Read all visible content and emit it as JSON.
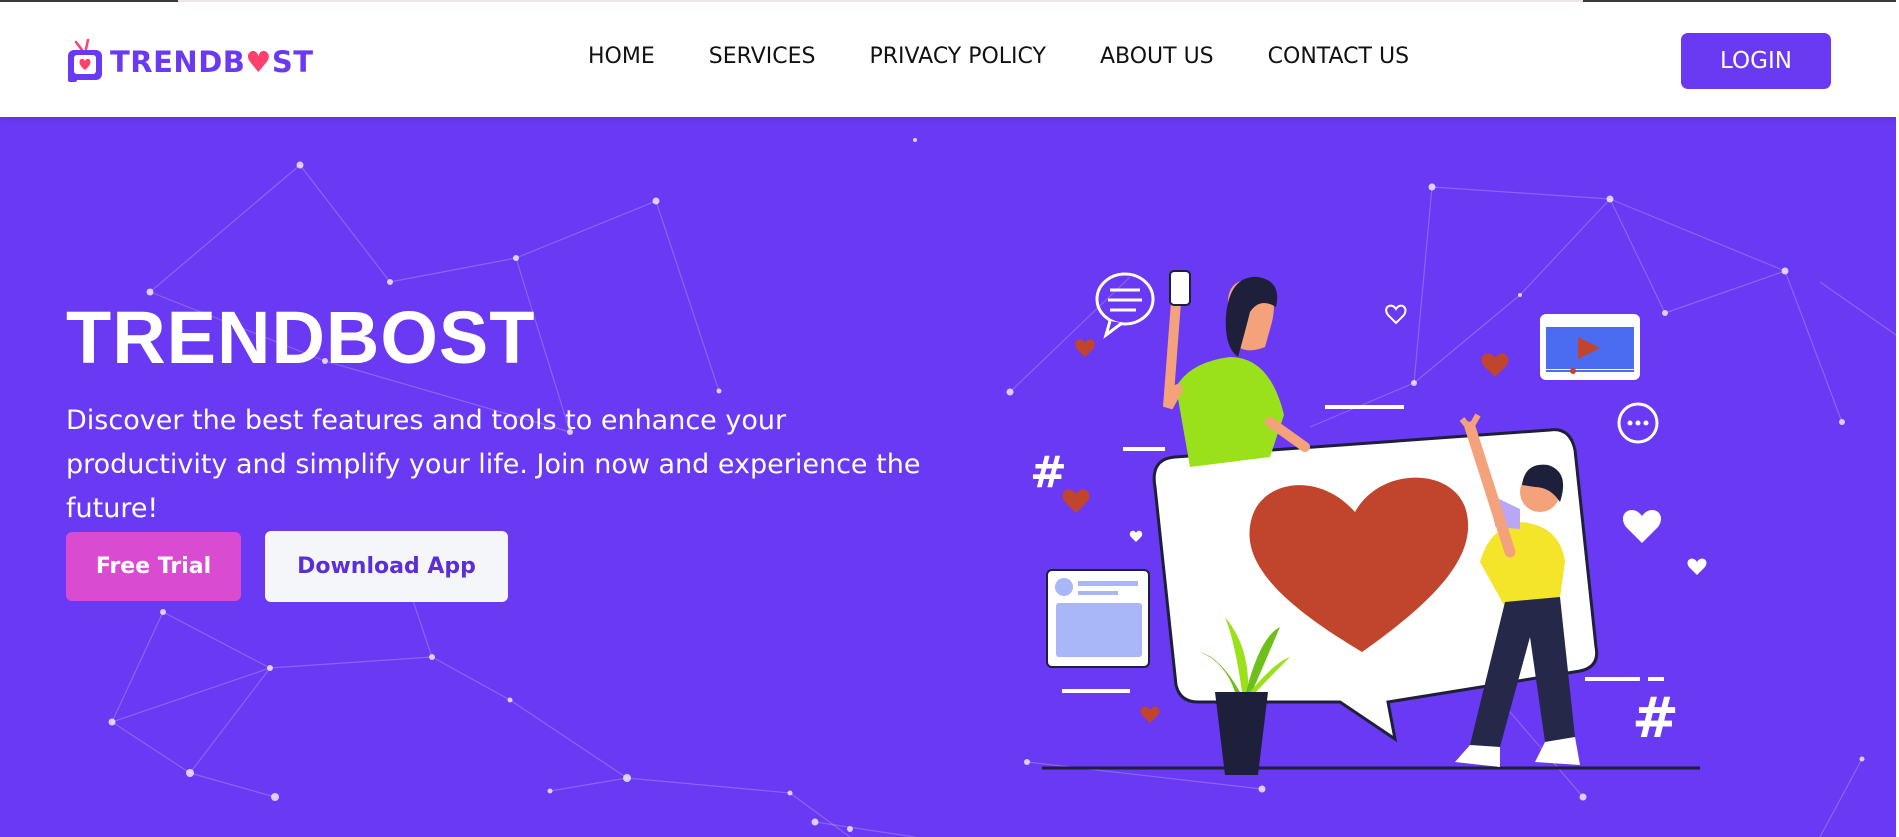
{
  "brand": {
    "name_part1": "TRENDB",
    "name_heart": "♥",
    "name_part2": "ST",
    "logo_icon": "tv-heart-icon",
    "color": "#6a3af2"
  },
  "nav": {
    "items": [
      {
        "label": "HOME"
      },
      {
        "label": "SERVICES"
      },
      {
        "label": "PRIVACY POLICY"
      },
      {
        "label": "ABOUT US"
      },
      {
        "label": "CONTACT US"
      }
    ],
    "login_label": "LOGIN"
  },
  "hero": {
    "title": "TRENDBOST",
    "description": "Discover the best features and tools to enhance your productivity and simplify your life. Join now and experience the future!",
    "primary_button": "Free Trial",
    "secondary_button": "Download App",
    "background": "#6939f3",
    "illustration": "social-media-marketing-illustration"
  },
  "colors": {
    "primary": "#6a3af2",
    "accent_pink": "#d94bd1",
    "heart_red": "#c0452c"
  }
}
